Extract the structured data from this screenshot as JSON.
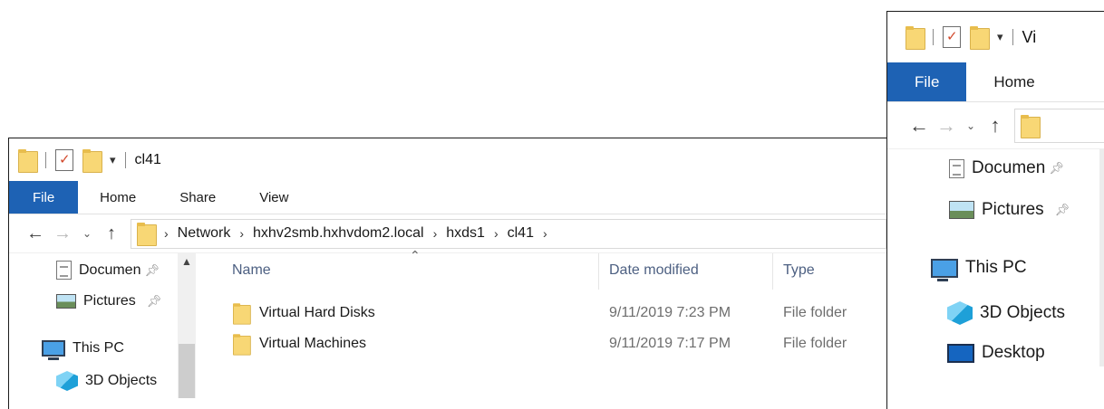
{
  "window_main": {
    "title": "cl41",
    "qa_dropdown": "▾",
    "ribbon": {
      "file": "File",
      "home": "Home",
      "share": "Share",
      "view": "View"
    },
    "nav": {
      "back": "←",
      "forward": "→",
      "recent": "⌄",
      "up": "↑"
    },
    "breadcrumb": [
      "Network",
      "hxhv2smb.hxhvdom2.local",
      "hxds1",
      "cl41"
    ],
    "breadcrumb_sep": "›",
    "sidebar": {
      "documents": "Documen",
      "pictures": "Pictures",
      "this_pc": "This PC",
      "objects_3d": "3D Objects"
    },
    "columns": {
      "name": "Name",
      "date": "Date modified",
      "type": "Type"
    },
    "files": [
      {
        "name": "Virtual Hard Disks",
        "date": "9/11/2019 7:23 PM",
        "type": "File folder"
      },
      {
        "name": "Virtual Machines",
        "date": "9/11/2019 7:17 PM",
        "type": "File folder"
      }
    ]
  },
  "window_side": {
    "title": "Vi",
    "qa_dropdown": "▾",
    "ribbon": {
      "file": "File",
      "home": "Home"
    },
    "nav": {
      "back": "←",
      "forward": "→",
      "recent": "⌄",
      "up": "↑"
    },
    "sidebar": {
      "documents": "Documen",
      "pictures": "Pictures",
      "this_pc": "This PC",
      "objects_3d": "3D Objects",
      "desktop": "Desktop"
    }
  },
  "colors": {
    "file_tab": "#1e62b4",
    "folder": "#f8d775",
    "column_header": "#4d6082"
  }
}
